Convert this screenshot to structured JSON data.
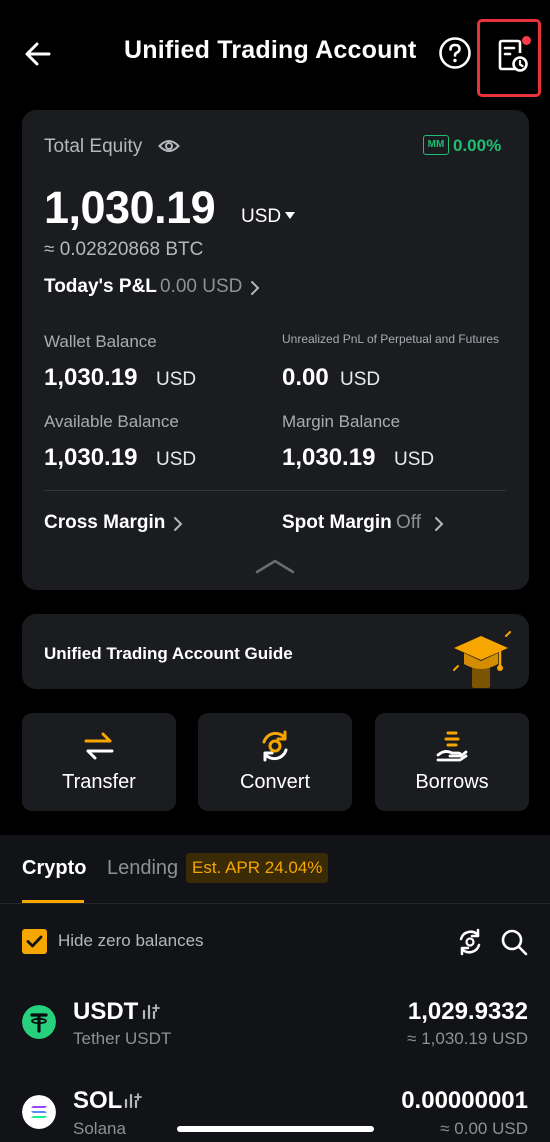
{
  "header": {
    "title": "Unified Trading Account"
  },
  "equity": {
    "label": "Total Equity",
    "mm_badge": "MM",
    "mm_value": "0.00%",
    "amount": "1,030.19",
    "currency": "USD",
    "btc_approx": "≈ 0.02820868 BTC",
    "pnl_label": "Today's P&L",
    "pnl_value": "0.00 USD",
    "wallet_balance": {
      "label": "Wallet Balance",
      "value": "1,030.19",
      "unit": "USD"
    },
    "unrealized_pnl": {
      "label": "Unrealized PnL of Perpetual and Futures",
      "value": "0.00",
      "unit": "USD"
    },
    "available_balance": {
      "label": "Available Balance",
      "value": "1,030.19",
      "unit": "USD"
    },
    "margin_balance": {
      "label": "Margin Balance",
      "value": "1,030.19",
      "unit": "USD"
    },
    "cross_margin": "Cross Margin",
    "spot_margin": {
      "label": "Spot Margin",
      "state": "Off"
    }
  },
  "guide": {
    "title": "Unified Trading Account Guide"
  },
  "actions": [
    {
      "label": "Transfer",
      "icon": "transfer-icon"
    },
    {
      "label": "Convert",
      "icon": "convert-icon"
    },
    {
      "label": "Borrows",
      "icon": "borrows-icon"
    }
  ],
  "tabs": {
    "crypto": "Crypto",
    "lending": "Lending",
    "apr_badge": "Est. APR 24.04%"
  },
  "filter": {
    "hide_zero_label": "Hide zero balances",
    "hide_zero_checked": true
  },
  "assets": [
    {
      "symbol": "USDT",
      "name": "Tether USDT",
      "amount": "1,029.9332",
      "value": "≈ 1,030.19 USD",
      "color": "#26d07c"
    },
    {
      "symbol": "SOL",
      "name": "Solana",
      "amount": "0.00000001",
      "value": "≈ 0.00 USD",
      "color": "#ffffff"
    }
  ],
  "colors": {
    "accent": "#f7a600",
    "positive": "#1dbf73",
    "alert": "#e8333a",
    "card_bg": "#1b1c20"
  }
}
